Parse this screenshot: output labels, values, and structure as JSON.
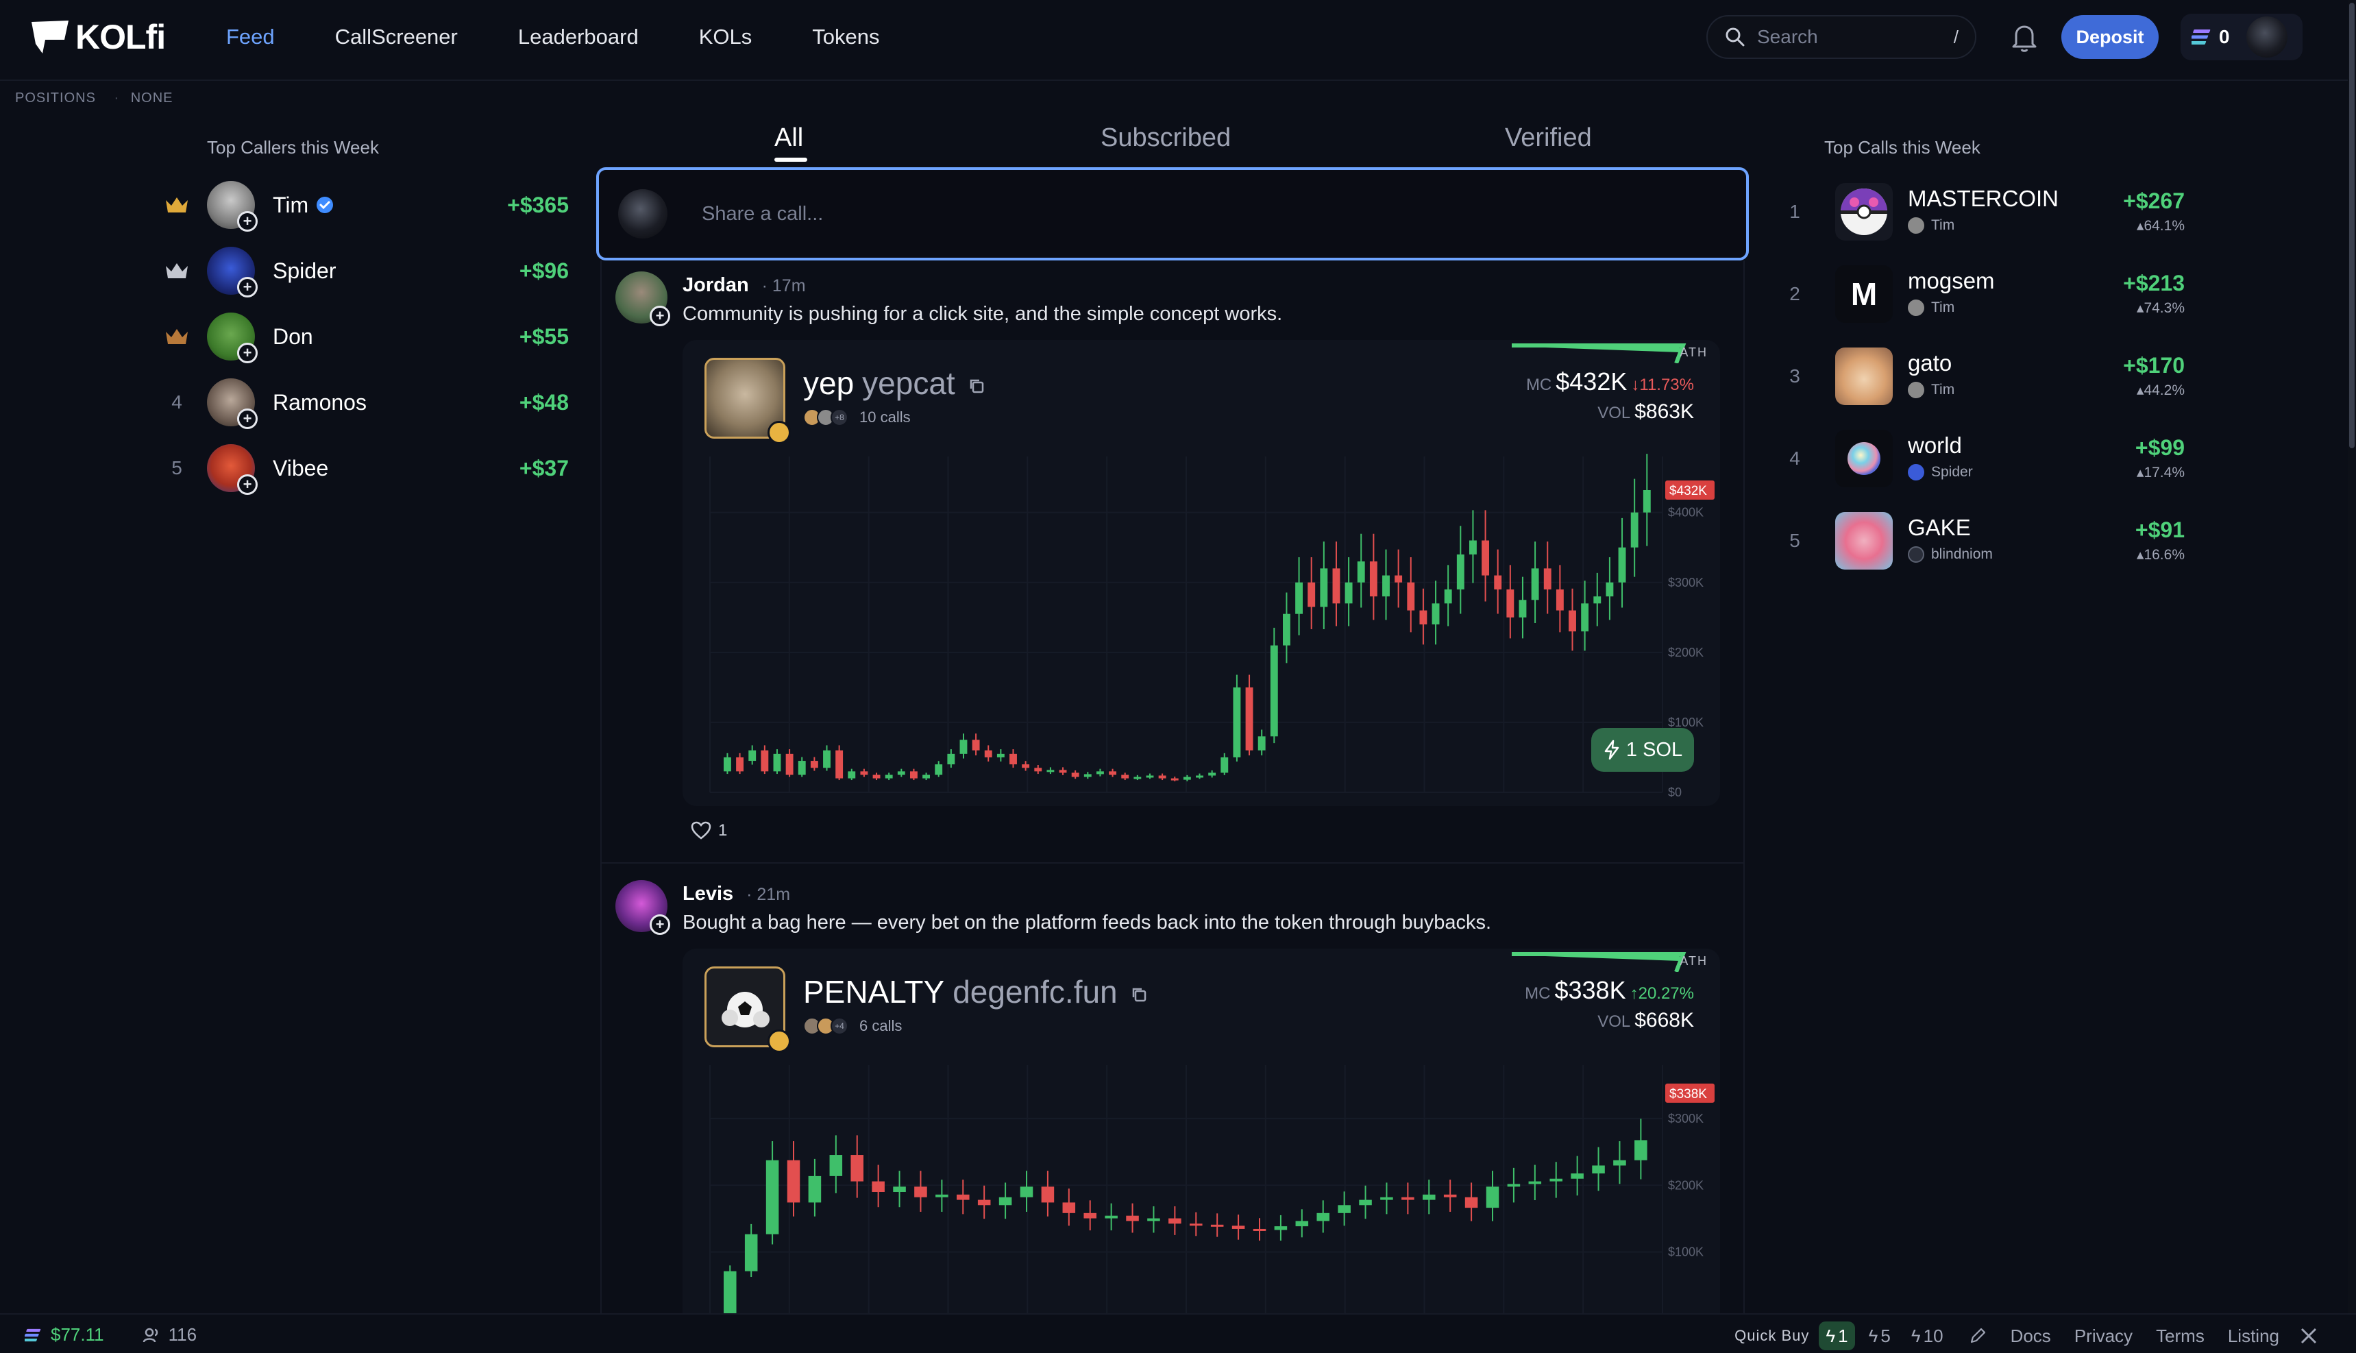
{
  "nav": {
    "logo": "KOLfi",
    "links": [
      {
        "label": "Feed",
        "active": true
      },
      {
        "label": "CallScreener",
        "active": false
      },
      {
        "label": "Leaderboard",
        "active": false
      },
      {
        "label": "KOLs",
        "active": false
      },
      {
        "label": "Tokens",
        "active": false
      }
    ],
    "search_placeholder": "Search",
    "search_shortcut": "/",
    "deposit_label": "Deposit",
    "wallet_count": "0"
  },
  "positions": {
    "label": "POSITIONS",
    "value": "NONE"
  },
  "top_callers": {
    "title": "Top Callers this Week",
    "items": [
      {
        "rank": "1",
        "crown": "gold",
        "name": "Tim",
        "verified": true,
        "pnl": "+$365"
      },
      {
        "rank": "2",
        "crown": "silver",
        "name": "Spider",
        "verified": false,
        "pnl": "+$96"
      },
      {
        "rank": "3",
        "crown": "bronze",
        "name": "Don",
        "verified": false,
        "pnl": "+$55"
      },
      {
        "rank": "4",
        "crown": "",
        "name": "Ramonos",
        "verified": false,
        "pnl": "+$48"
      },
      {
        "rank": "5",
        "crown": "",
        "name": "Vibee",
        "verified": false,
        "pnl": "+$37"
      }
    ]
  },
  "feed": {
    "tabs": [
      "All",
      "Subscribed",
      "Verified"
    ],
    "active_tab": "All",
    "compose_placeholder": "Share a call...",
    "posts": [
      {
        "author": "Jordan",
        "time": "17m",
        "text": "Community is pushing for a click site, and the simple concept works.",
        "token": {
          "name": "yep",
          "ticker": "yepcat",
          "calls": "10 calls",
          "more_callers": "+8",
          "mc_label": "MC",
          "mc": "$432K",
          "change": "11.73%",
          "direction": "down",
          "vol_label": "VOL",
          "vol": "$863K",
          "ath_label": "ATH",
          "price_tag": "$432K",
          "quick_buy": "1 SOL"
        },
        "likes": "1"
      },
      {
        "author": "Levis",
        "time": "21m",
        "text": "Bought a bag here — every bet on the platform feeds back into the token through buybacks.",
        "token": {
          "name": "PENALTY",
          "ticker": "degenfc.fun",
          "calls": "6 calls",
          "more_callers": "+4",
          "mc_label": "MC",
          "mc": "$338K",
          "change": "20.27%",
          "direction": "up",
          "vol_label": "VOL",
          "vol": "$668K",
          "ath_label": "ATH",
          "price_tag": "$338K"
        }
      }
    ]
  },
  "chart_data": [
    {
      "type": "candlestick",
      "series_label": "yepcat market cap",
      "y_ticks": [
        "$400K",
        "$300K",
        "$200K",
        "$100K",
        "$0"
      ],
      "ylim": [
        0,
        480000
      ],
      "last_value": 432000,
      "ath_label": "ATH",
      "grid": true,
      "candles_approx": [
        [
          30,
          50
        ],
        [
          50,
          30
        ],
        [
          45,
          60
        ],
        [
          60,
          30
        ],
        [
          30,
          55
        ],
        [
          55,
          25
        ],
        [
          25,
          45
        ],
        [
          45,
          35
        ],
        [
          35,
          60
        ],
        [
          60,
          20
        ],
        [
          20,
          30
        ],
        [
          30,
          25
        ],
        [
          25,
          20
        ],
        [
          20,
          25
        ],
        [
          25,
          30
        ],
        [
          30,
          20
        ],
        [
          20,
          25
        ],
        [
          25,
          40
        ],
        [
          40,
          55
        ],
        [
          55,
          75
        ],
        [
          75,
          60
        ],
        [
          60,
          50
        ],
        [
          50,
          55
        ],
        [
          55,
          40
        ],
        [
          40,
          35
        ],
        [
          35,
          30
        ],
        [
          30,
          32
        ],
        [
          32,
          28
        ],
        [
          28,
          22
        ],
        [
          22,
          26
        ],
        [
          26,
          30
        ],
        [
          30,
          25
        ],
        [
          25,
          20
        ],
        [
          20,
          22
        ],
        [
          22,
          24
        ],
        [
          24,
          20
        ],
        [
          20,
          18
        ],
        [
          18,
          22
        ],
        [
          22,
          24
        ],
        [
          24,
          28
        ],
        [
          28,
          50
        ],
        [
          50,
          150
        ],
        [
          150,
          60
        ],
        [
          60,
          80
        ],
        [
          80,
          210
        ],
        [
          210,
          255
        ],
        [
          255,
          300
        ],
        [
          300,
          265
        ],
        [
          265,
          320
        ],
        [
          320,
          270
        ],
        [
          270,
          300
        ],
        [
          300,
          330
        ],
        [
          330,
          280
        ],
        [
          280,
          310
        ],
        [
          310,
          300
        ],
        [
          300,
          260
        ],
        [
          260,
          240
        ],
        [
          240,
          270
        ],
        [
          270,
          290
        ],
        [
          290,
          340
        ],
        [
          340,
          360
        ],
        [
          360,
          310
        ],
        [
          310,
          290
        ],
        [
          290,
          250
        ],
        [
          250,
          275
        ],
        [
          275,
          320
        ],
        [
          320,
          290
        ],
        [
          290,
          260
        ],
        [
          260,
          230
        ],
        [
          230,
          270
        ],
        [
          270,
          280
        ],
        [
          280,
          300
        ],
        [
          300,
          350
        ],
        [
          350,
          400
        ],
        [
          400,
          432
        ]
      ]
    },
    {
      "type": "candlestick",
      "series_label": "degenfc.fun market cap",
      "y_ticks": [
        "$300K",
        "$200K",
        "$100K"
      ],
      "ylim": [
        0,
        380000
      ],
      "last_value": 338000,
      "ath_label": "ATH",
      "grid": true
    }
  ],
  "top_calls": {
    "title": "Top Calls this Week",
    "items": [
      {
        "rank": "1",
        "name": "MASTERCOIN",
        "by": "Tim",
        "pnl": "+$267",
        "pct": "64.1%",
        "icon": "masterball-icon"
      },
      {
        "rank": "2",
        "name": "mogsem",
        "by": "Tim",
        "pnl": "+$213",
        "pct": "74.3%",
        "icon": "letter-m-icon",
        "letter": "M"
      },
      {
        "rank": "3",
        "name": "gato",
        "by": "Tim",
        "pnl": "+$170",
        "pct": "44.2%",
        "icon": "cat-icon"
      },
      {
        "rank": "4",
        "name": "world",
        "by": "Spider",
        "pnl": "+$99",
        "pct": "17.4%",
        "icon": "orb-icon"
      },
      {
        "rank": "5",
        "name": "GAKE",
        "by": "blindniom",
        "pnl": "+$91",
        "pct": "16.6%",
        "icon": "cartoon-icon"
      }
    ]
  },
  "footer": {
    "balance": "$77.11",
    "users": "116",
    "quick_buy_label": "Quick Buy",
    "quick_buy_options": [
      "1",
      "5",
      "10"
    ],
    "links": [
      "Docs",
      "Privacy",
      "Terms",
      "Listing"
    ]
  },
  "colors": {
    "accent": "#6ea4ff",
    "positive": "#4fd17a",
    "negative": "#e85a5a",
    "deposit": "#3f6bd8",
    "background": "#0b0e17"
  }
}
